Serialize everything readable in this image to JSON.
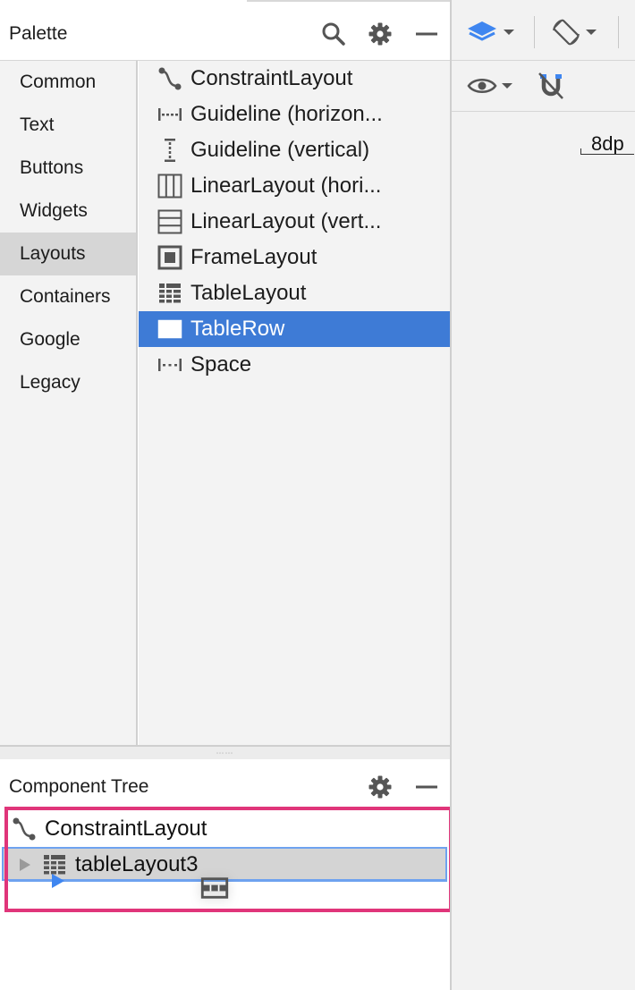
{
  "palette": {
    "title": "Palette",
    "categories": [
      {
        "label": "Common",
        "selected": false
      },
      {
        "label": "Text",
        "selected": false
      },
      {
        "label": "Buttons",
        "selected": false
      },
      {
        "label": "Widgets",
        "selected": false
      },
      {
        "label": "Layouts",
        "selected": true
      },
      {
        "label": "Containers",
        "selected": false
      },
      {
        "label": "Google",
        "selected": false
      },
      {
        "label": "Legacy",
        "selected": false
      }
    ],
    "items": [
      {
        "label": "ConstraintLayout",
        "icon": "constraint-layout-icon",
        "selected": false
      },
      {
        "label": "Guideline (horizon...",
        "icon": "guideline-horizontal-icon",
        "selected": false
      },
      {
        "label": "Guideline (vertical)",
        "icon": "guideline-vertical-icon",
        "selected": false
      },
      {
        "label": "LinearLayout (hori...",
        "icon": "linear-layout-horizontal-icon",
        "selected": false
      },
      {
        "label": "LinearLayout (vert...",
        "icon": "linear-layout-vertical-icon",
        "selected": false
      },
      {
        "label": "FrameLayout",
        "icon": "frame-layout-icon",
        "selected": false
      },
      {
        "label": "TableLayout",
        "icon": "table-layout-icon",
        "selected": false
      },
      {
        "label": "TableRow",
        "icon": "table-row-icon",
        "selected": true
      },
      {
        "label": "Space",
        "icon": "space-icon",
        "selected": false
      }
    ]
  },
  "component_tree": {
    "title": "Component Tree",
    "nodes": [
      {
        "label": "ConstraintLayout",
        "icon": "constraint-layout-icon"
      },
      {
        "label": "tableLayout3",
        "icon": "table-layout-icon",
        "selected": true
      }
    ],
    "drag_ghost_icon": "table-row-icon"
  },
  "design_toolbar": {
    "design_surface_icon": "layers-icon",
    "orientation_icon": "rotate-device-icon",
    "view_options_icon": "eye-icon",
    "autoconnect_icon": "magnet-icon",
    "default_margin": "8dp"
  },
  "colors": {
    "selection": "#3e7bd6",
    "tree_highlight_border": "#e0357a",
    "drop_indicator": "#3f86f0",
    "panel_bg": "#f3f3f3",
    "category_selected_bg": "#d6d6d6"
  }
}
